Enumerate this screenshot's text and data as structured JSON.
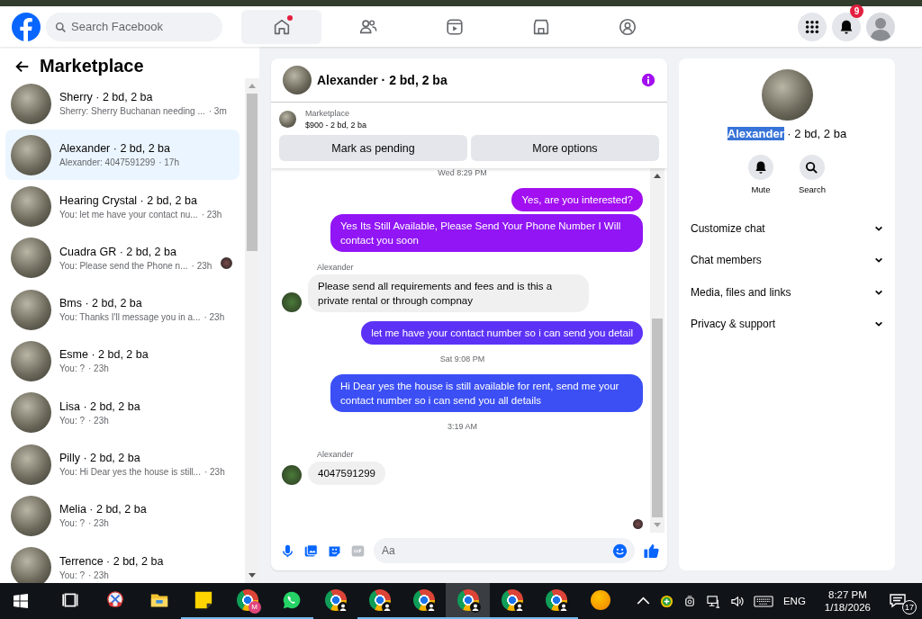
{
  "top_bar": {
    "search": {
      "placeholder": "Search Facebook"
    },
    "nav_tabs": [
      {
        "kind": "home",
        "selected": true,
        "dot": true
      },
      {
        "kind": "friends",
        "selected": false,
        "dot": false
      },
      {
        "kind": "video",
        "selected": false,
        "dot": false
      },
      {
        "kind": "store",
        "selected": false,
        "dot": false
      },
      {
        "kind": "groups",
        "selected": false,
        "dot": false
      }
    ],
    "notifications_badge": "9"
  },
  "sidebar": {
    "title": "Marketplace",
    "conversations": [
      {
        "title": "Sherry · 2 bd, 2 ba",
        "preview": "Sherry: Sherry Buchanan needing ...",
        "time": "· 3m",
        "selected": false,
        "seen": false
      },
      {
        "title": "Alexander · 2 bd, 2 ba",
        "preview": "Alexander: 4047591299",
        "time": "· 17h",
        "selected": true,
        "seen": false
      },
      {
        "title": "Hearing Crystal · 2 bd, 2 ba",
        "preview": "You: let me have your contact nu...",
        "time": "· 23h",
        "selected": false,
        "seen": false
      },
      {
        "title": "Cuadra GR · 2 bd, 2 ba",
        "preview": "You: Please send the Phone n...",
        "time": "· 23h",
        "selected": false,
        "seen": true
      },
      {
        "title": "Bms · 2 bd, 2 ba",
        "preview": "You: Thanks I'll message you in a...",
        "time": "· 23h",
        "selected": false,
        "seen": false
      },
      {
        "title": "Esme · 2 bd, 2 ba",
        "preview": "You: ?",
        "time": "· 23h",
        "selected": false,
        "seen": false
      },
      {
        "title": "Lisa · 2 bd, 2 ba",
        "preview": "You: ?",
        "time": "· 23h",
        "selected": false,
        "seen": false
      },
      {
        "title": "Pilly · 2 bd, 2 ba",
        "preview": "You: Hi Dear yes the house is still...",
        "time": "· 23h",
        "selected": false,
        "seen": false
      },
      {
        "title": "Melia · 2 bd, 2 ba",
        "preview": "You: ?",
        "time": "· 23h",
        "selected": false,
        "seen": false
      },
      {
        "title": "Terrence · 2 bd, 2 ba",
        "preview": "You: ?",
        "time": "· 23h",
        "selected": false,
        "seen": false
      }
    ]
  },
  "chat": {
    "title": "Alexander · 2 bd, 2 ba",
    "listing": {
      "label": "Marketplace",
      "price": "$900 - 2 bd, 2 ba"
    },
    "buttons": [
      "Mark as pending",
      "More options"
    ],
    "messages": [
      {
        "kind": "time",
        "text": "Wed 8:29 PM"
      },
      {
        "kind": "sent",
        "text": "Yes, are you interested?",
        "color": "#a20ff0"
      },
      {
        "kind": "sent",
        "text": "Yes Its Still Available, Please Send Your Phone Number I Will contact you soon",
        "color": "#9115f5"
      },
      {
        "kind": "received",
        "sender": "Alexander",
        "text": "Please send all requirements and fees and is this a private rental or through compnay"
      },
      {
        "kind": "sent",
        "text": "let me have your contact number so i can send you detail",
        "color": "#5c33f6"
      },
      {
        "kind": "time",
        "text": "Sat 9:08 PM"
      },
      {
        "kind": "sent",
        "text": "Hi Dear yes the house is still available for rent, send me your contact number so i can send you all details",
        "color": "#3b4ff4"
      },
      {
        "kind": "time",
        "text": "3:19 AM"
      },
      {
        "kind": "received",
        "sender": "Alexander",
        "text": "4047591299"
      },
      {
        "kind": "seen"
      }
    ],
    "composer": {
      "placeholder": "Aa"
    }
  },
  "profile": {
    "name": "Alexander",
    "name_selected": true,
    "detail": " · 2 bd, 2 ba",
    "actions": [
      {
        "kind": "mute",
        "label": "Mute"
      },
      {
        "kind": "search",
        "label": "Search"
      }
    ],
    "sections": [
      {
        "label": "Customize chat",
        "expanded": false
      },
      {
        "label": "Chat members",
        "expanded": false
      },
      {
        "label": "Media, files and links",
        "expanded": false
      },
      {
        "label": "Privacy & support",
        "expanded": false
      }
    ]
  },
  "taskbar": {
    "apps": [
      {
        "kind": "taskview",
        "running": false,
        "selected": false
      },
      {
        "kind": "snip",
        "running": false,
        "selected": false
      },
      {
        "kind": "folder",
        "running": false,
        "selected": false
      },
      {
        "kind": "note",
        "running": true,
        "selected": false
      },
      {
        "kind": "browser",
        "badge": "M",
        "running": true,
        "selected": false
      },
      {
        "kind": "chat",
        "running": true,
        "selected": false
      },
      {
        "kind": "browser-profile",
        "running": false,
        "selected": false
      },
      {
        "kind": "browser-profile",
        "running": true,
        "selected": false
      },
      {
        "kind": "browser-profile",
        "running": true,
        "selected": false
      },
      {
        "kind": "browser-profile",
        "running": true,
        "selected": true
      },
      {
        "kind": "browser-profile",
        "running": true,
        "selected": false
      },
      {
        "kind": "browser-profile",
        "running": true,
        "selected": false
      },
      {
        "kind": "orb",
        "running": false,
        "selected": false
      }
    ],
    "language": "ENG",
    "time": "8:27 PM",
    "date": "1/18/2026",
    "notifications": "17"
  }
}
